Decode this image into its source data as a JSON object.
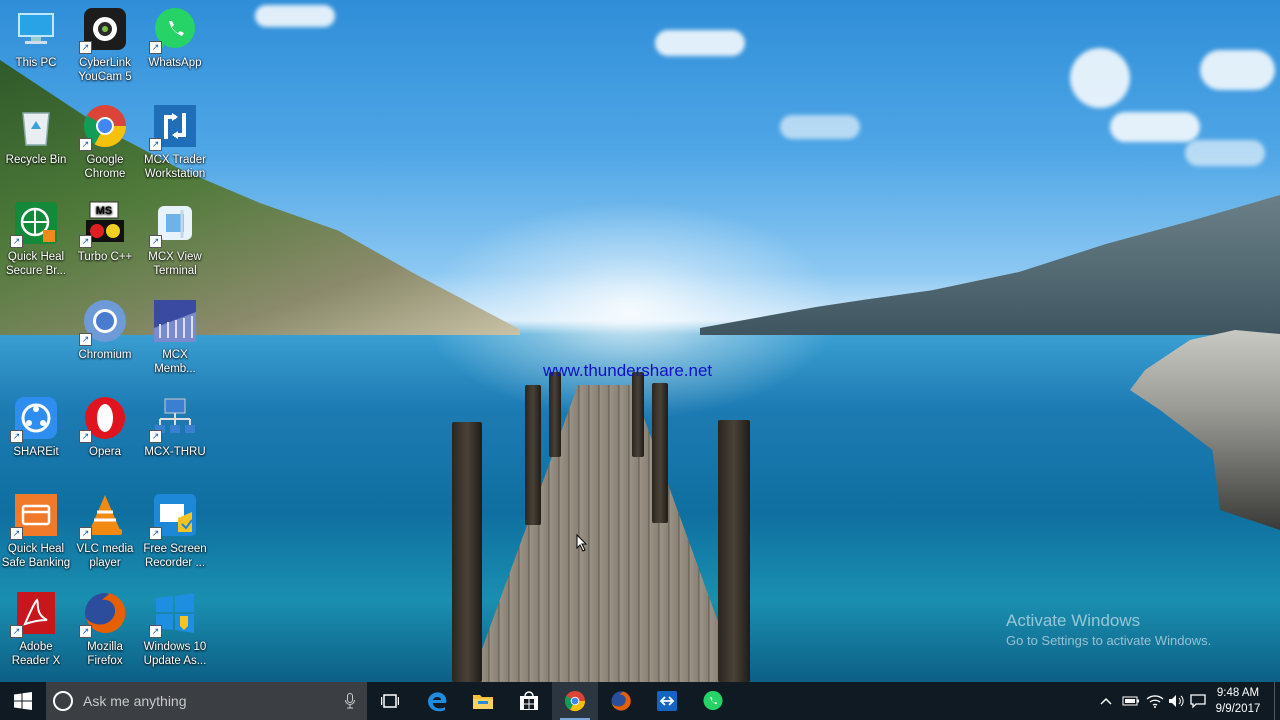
{
  "desktop": {
    "watermark": "www.thundershare.net",
    "activation": {
      "title": "Activate Windows",
      "subtitle": "Go to Settings to activate Windows."
    },
    "icons": [
      {
        "label": "This PC",
        "icon": "this-pc-icon"
      },
      {
        "label": "CyberLink\nYouCam 5",
        "icon": "youcam-icon"
      },
      {
        "label": "WhatsApp",
        "icon": "whatsapp-icon"
      },
      {
        "label": "Recycle Bin",
        "icon": "recycle-bin-icon"
      },
      {
        "label": "Google\nChrome",
        "icon": "chrome-icon"
      },
      {
        "label": "MCX Trader\nWorkstation",
        "icon": "mcx-trader-icon"
      },
      {
        "label": "Quick Heal\nSecure Br...",
        "icon": "quick-heal-browser-icon"
      },
      {
        "label": "Turbo C++",
        "icon": "turbo-cpp-icon"
      },
      {
        "label": "MCX View\nTerminal",
        "icon": "mcx-view-icon"
      },
      {
        "label": "Chromium",
        "icon": "chromium-icon"
      },
      {
        "label": "MCX\nMemb...",
        "icon": "mcx-member-icon"
      },
      {
        "label": "SHAREit",
        "icon": "shareit-icon"
      },
      {
        "label": "Opera",
        "icon": "opera-icon"
      },
      {
        "label": "MCX-THRU",
        "icon": "mcx-thru-icon"
      },
      {
        "label": "Quick Heal\nSafe Banking",
        "icon": "safe-banking-icon"
      },
      {
        "label": "VLC media\nplayer",
        "icon": "vlc-icon"
      },
      {
        "label": "Free Screen\nRecorder ...",
        "icon": "screen-recorder-icon"
      },
      {
        "label": "Adobe\nReader X",
        "icon": "adobe-reader-icon"
      },
      {
        "label": "Mozilla\nFirefox",
        "icon": "firefox-icon"
      },
      {
        "label": "Windows 10\nUpdate As...",
        "icon": "windows-update-icon"
      }
    ]
  },
  "taskbar": {
    "search_placeholder": "Ask me anything",
    "pinned": [
      "edge-icon",
      "file-explorer-icon",
      "store-icon",
      "chrome-icon",
      "firefox-icon",
      "teamviewer-icon",
      "whatsapp-icon"
    ],
    "clock": {
      "time": "9:48 AM",
      "date": "9/9/2017"
    }
  }
}
